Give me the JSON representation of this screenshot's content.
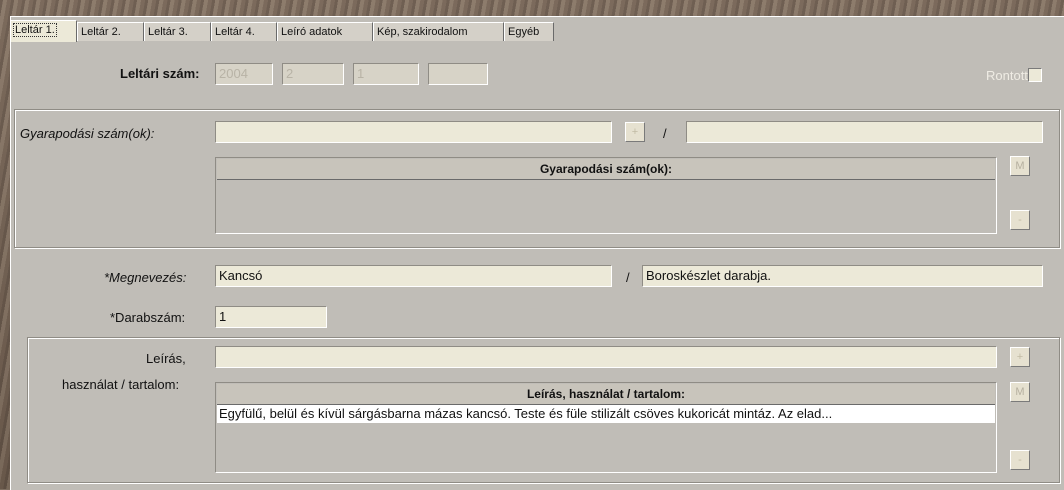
{
  "tabs": [
    "Leltár 1.",
    "Leltár 2.",
    "Leltár 3.",
    "Leltár 4.",
    "Leíró adatok",
    "Kép, szakirodalom",
    "Egyéb"
  ],
  "leltari_szam": {
    "label": "Leltári szám:",
    "values": [
      "2004",
      "2",
      "1",
      ""
    ]
  },
  "rontott": {
    "label": "Rontott:"
  },
  "gyarapodasi": {
    "label": "Gyarapodási szám(ok):",
    "value": "",
    "plus": "+",
    "separator": "/",
    "value2": "",
    "grid_header": "Gyarapodási szám(ok):",
    "m_button": "M",
    "minus_button": "-"
  },
  "megnevezes": {
    "label": "*Megnevezés:",
    "value": "Kancsó",
    "separator": "/",
    "value2": "Boroskészlet darabja."
  },
  "darabszam": {
    "label": "*Darabszám:",
    "value": "1"
  },
  "leiras": {
    "label_line1": "Leírás,",
    "label_line2": "használat / tartalom:",
    "value": "",
    "plus": "+",
    "grid_header": "Leírás, használat / tartalom:",
    "m_button": "M",
    "minus_button": "-",
    "row": "Egyfülű, belül és kívül sárgásbarna mázas kancsó. Teste és füle stilizált csöves kukoricát mintáz. Az elad..."
  }
}
